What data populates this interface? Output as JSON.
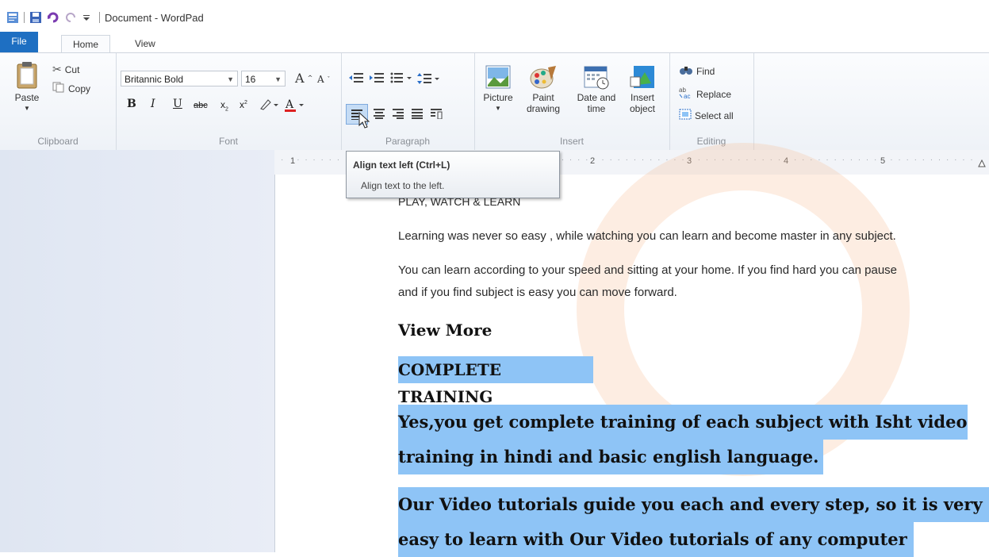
{
  "window": {
    "title": "Document - WordPad"
  },
  "tabs": [
    {
      "label": "File"
    },
    {
      "label": "Home"
    },
    {
      "label": "View"
    }
  ],
  "clipboard": {
    "paste": "Paste",
    "cut": "Cut",
    "copy": "Copy",
    "group_label": "Clipboard"
  },
  "font": {
    "family": "Britannic Bold",
    "size": "16",
    "group_label": "Font"
  },
  "paragraph": {
    "group_label": "Paragraph"
  },
  "insert": {
    "picture": "Picture",
    "paint_drawing_1": "Paint",
    "paint_drawing_2": "drawing",
    "date_time_1": "Date and",
    "date_time_2": "time",
    "insert_object_1": "Insert",
    "insert_object_2": "object",
    "group_label": "Insert"
  },
  "editing": {
    "find": "Find",
    "replace": "Replace",
    "select_all": "Select all",
    "group_label": "Editing"
  },
  "ruler": {
    "marks": [
      "1",
      "2",
      "3",
      "4",
      "5"
    ]
  },
  "tooltip": {
    "title": "Align text left (Ctrl+L)",
    "body": "Align text to the left."
  },
  "document": {
    "line1": "PLAY, WATCH & LEARN",
    "para1": "Learning was never so easy , while watching you can learn and become master in any subject.",
    "para2a": "You can learn according to your speed and sitting at your home. If you find hard you can pause",
    "para2b": "and if you find subject is easy you can move forward.",
    "heading1": "View More",
    "heading2": "COMPLETE TRAINING",
    "big1a": "Yes,you get complete training of each subject with Isht video",
    "big1b": "training in hindi and basic english language.",
    "big2a": "Our Video tutorials guide you each and every step, so it is very",
    "big2b": "easy to learn with Our Video tutorials of any computer"
  },
  "colors": {
    "file_tab": "#1e6fc2",
    "selection": "#8ec4f6"
  }
}
